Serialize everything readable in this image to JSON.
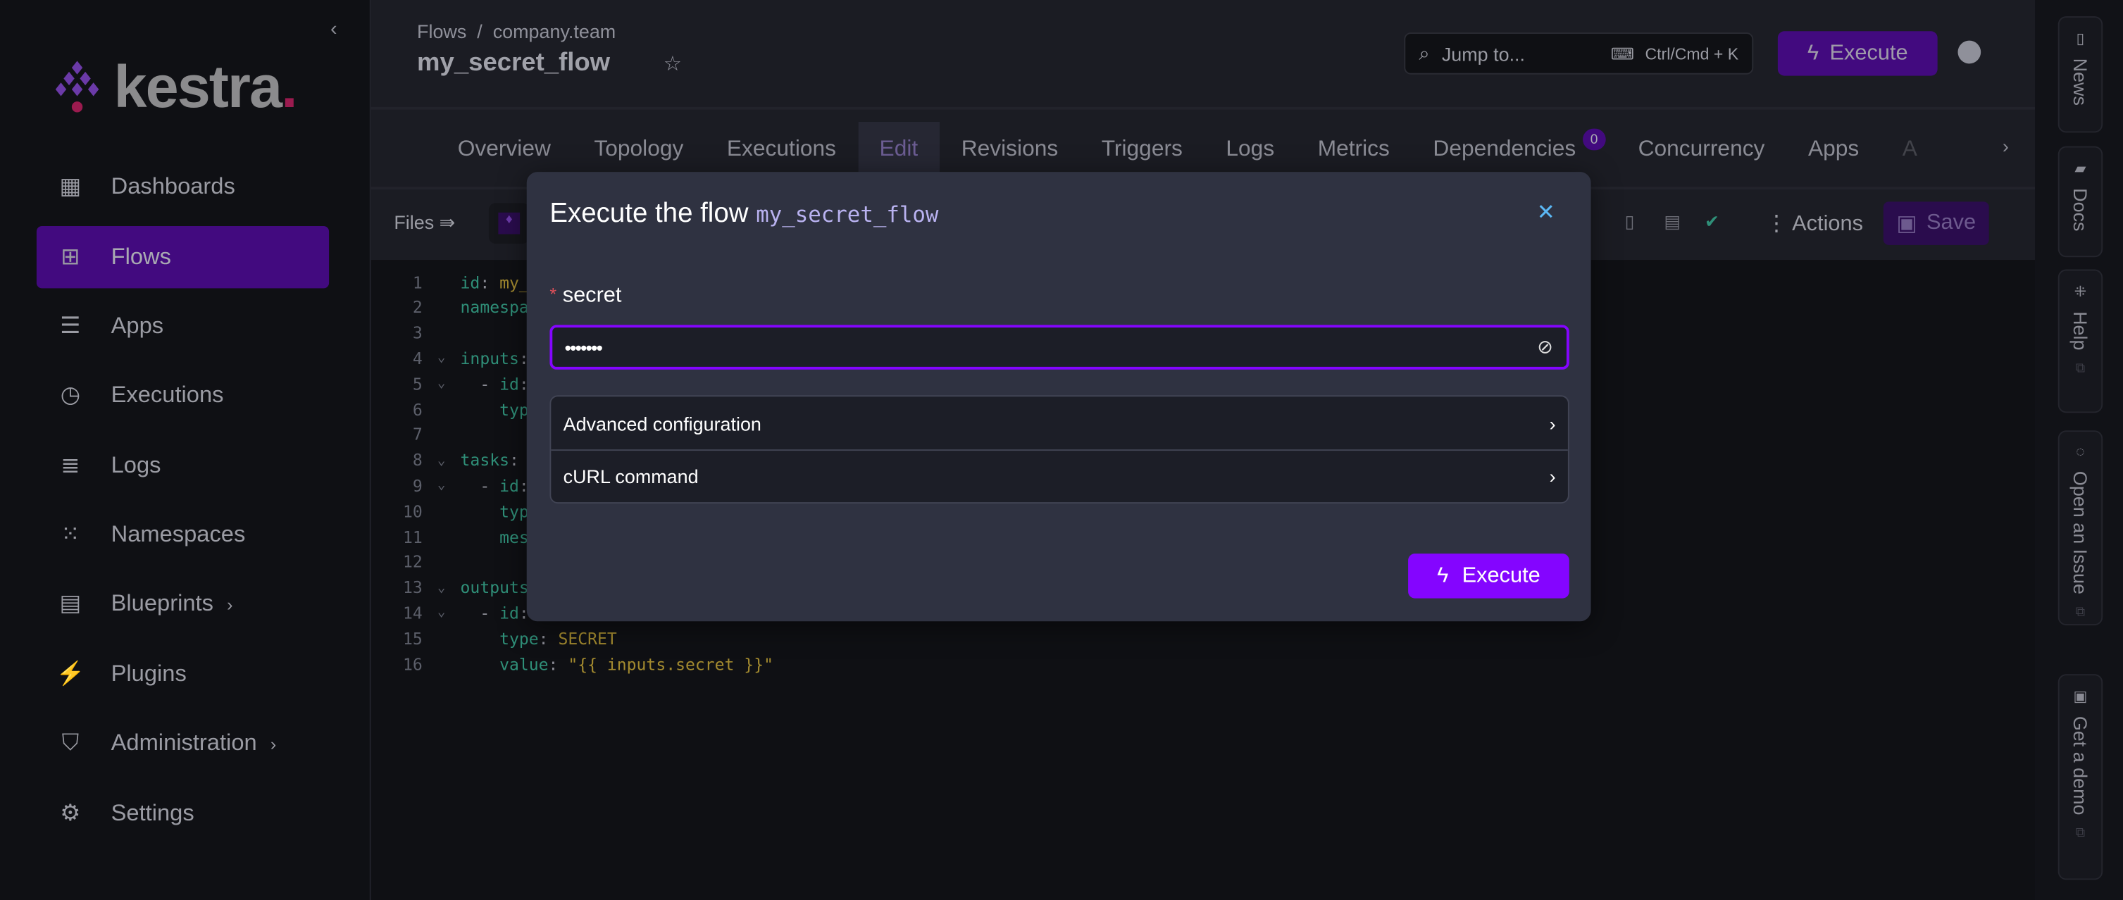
{
  "sidebar": {
    "logo_text": "kestra",
    "items": [
      {
        "label": "Dashboards",
        "icon": "dashboard-icon"
      },
      {
        "label": "Flows",
        "icon": "flows-icon",
        "active": true
      },
      {
        "label": "Apps",
        "icon": "apps-icon"
      },
      {
        "label": "Executions",
        "icon": "executions-icon"
      },
      {
        "label": "Logs",
        "icon": "logs-icon"
      },
      {
        "label": "Namespaces",
        "icon": "namespaces-icon"
      },
      {
        "label": "Blueprints",
        "icon": "blueprints-icon",
        "has_submenu": true
      },
      {
        "label": "Plugins",
        "icon": "plugins-icon"
      },
      {
        "label": "Administration",
        "icon": "administration-icon",
        "has_submenu": true
      },
      {
        "label": "Settings",
        "icon": "settings-icon"
      }
    ]
  },
  "header": {
    "breadcrumb": [
      "Flows",
      "company.team"
    ],
    "breadcrumb_sep": "/",
    "title": "my_secret_flow",
    "jump_placeholder": "Jump to...",
    "jump_shortcut": "Ctrl/Cmd + K",
    "execute_label": "Execute"
  },
  "tabs": [
    {
      "label": "Overview"
    },
    {
      "label": "Topology"
    },
    {
      "label": "Executions"
    },
    {
      "label": "Edit",
      "active": true
    },
    {
      "label": "Revisions"
    },
    {
      "label": "Triggers"
    },
    {
      "label": "Logs"
    },
    {
      "label": "Metrics"
    },
    {
      "label": "Dependencies",
      "badge": "0"
    },
    {
      "label": "Concurrency"
    },
    {
      "label": "Apps"
    },
    {
      "label": "A"
    }
  ],
  "toolbar": {
    "files_label": "Files",
    "actions_label": "Actions",
    "save_label": "Save"
  },
  "editor": {
    "lines": [
      {
        "n": "1",
        "k": "id",
        "p": ":",
        "v": " my_"
      },
      {
        "n": "2",
        "k": "namespa",
        "p": "",
        "v": ""
      },
      {
        "n": "3",
        "k": "",
        "p": "",
        "v": ""
      },
      {
        "n": "4",
        "fold": true,
        "k": "inputs",
        "p": ":",
        "v": ""
      },
      {
        "n": "5",
        "fold": true,
        "indent": "  - ",
        "k": "id",
        "p": ":",
        "v": ""
      },
      {
        "n": "6",
        "indent": "    ",
        "k": "typ",
        "p": "",
        "v": ""
      },
      {
        "n": "7",
        "k": "",
        "p": "",
        "v": ""
      },
      {
        "n": "8",
        "fold": true,
        "k": "tasks",
        "p": ":",
        "v": ""
      },
      {
        "n": "9",
        "fold": true,
        "indent": "  - ",
        "k": "id",
        "p": ":",
        "v": ""
      },
      {
        "n": "10",
        "indent": "    ",
        "k": "typ",
        "p": "",
        "v": ""
      },
      {
        "n": "11",
        "indent": "    ",
        "k": "mes",
        "p": "",
        "v": ""
      },
      {
        "n": "12",
        "k": "",
        "p": "",
        "v": ""
      },
      {
        "n": "13",
        "fold": true,
        "k": "outputs",
        "p": ":",
        "v": ""
      },
      {
        "n": "14",
        "fold": true,
        "indent": "  - ",
        "k": "id",
        "p": ":",
        "v": ""
      },
      {
        "n": "15",
        "indent": "    ",
        "k": "type",
        "p": ": ",
        "v": "SECRET"
      },
      {
        "n": "16",
        "indent": "    ",
        "k": "value",
        "p": ": ",
        "v": "\"{{ inputs.secret }}\""
      }
    ]
  },
  "right_sidebar": [
    {
      "label": "News",
      "icon": "news-icon"
    },
    {
      "label": "Docs",
      "icon": "docs-icon"
    },
    {
      "label": "Help",
      "icon": "slack-icon"
    },
    {
      "label": "Open an Issue",
      "icon": "github-icon"
    },
    {
      "label": "Get a demo",
      "icon": "demo-icon"
    }
  ],
  "modal": {
    "title": "Execute the flow",
    "flow_id": "my_secret_flow",
    "input_label": "secret",
    "required_mark": "*",
    "input_value": "•••••••",
    "sections": [
      {
        "label": "Advanced configuration"
      },
      {
        "label": "cURL command"
      }
    ],
    "execute_label": "Execute"
  },
  "colors": {
    "accent": "#8405ff",
    "accent_dim": "#420a7f",
    "modal_bg": "#2f3241",
    "close": "#5bb8f5"
  }
}
